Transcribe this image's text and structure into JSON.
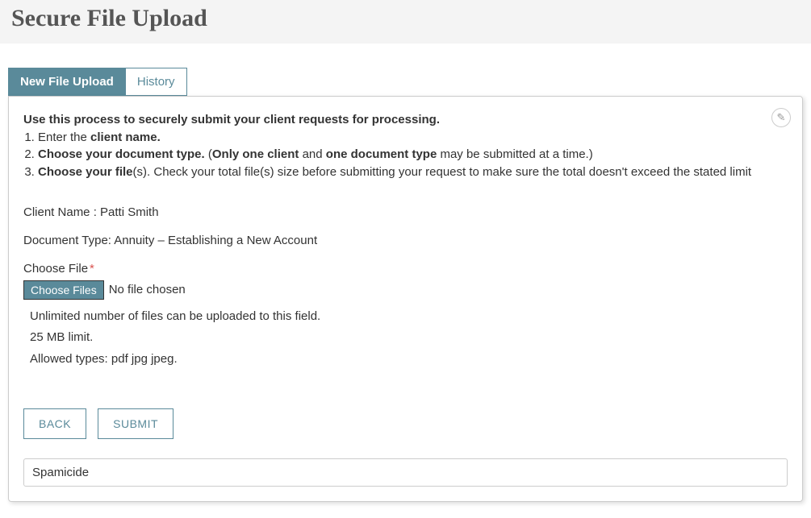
{
  "header": {
    "title": "Secure File Upload"
  },
  "tabs": {
    "new_upload": "New File Upload",
    "history": "History"
  },
  "edit_icon_name": "✎",
  "instructions": {
    "intro": "Use this process to securely submit your client requests for processing.",
    "step1_prefix": "Enter the ",
    "step1_bold": "client name.",
    "step2_bold1": "Choose your document type.",
    "step2_open_paren": " (",
    "step2_bold2": "Only one client",
    "step2_mid": " and ",
    "step2_bold3": "one document type",
    "step2_tail": " may be submitted at a time.)",
    "step3_bold": "Choose your file",
    "step3_tail": "(s). Check your total file(s) size before submitting your request to make sure the total doesn't exceed the stated limit"
  },
  "client": {
    "label": "Client Name : ",
    "value": "Patti Smith"
  },
  "document_type": {
    "label": "Document Type: ",
    "value": "Annuity – Establishing a New Account"
  },
  "file": {
    "label": "Choose File",
    "button": "Choose Files",
    "status": "No file chosen",
    "hints": {
      "unlimited": "Unlimited number of files can be uploaded to this field.",
      "limit": "25 MB limit.",
      "types": "Allowed types: pdf jpg jpeg."
    }
  },
  "actions": {
    "back": "BACK",
    "submit": "SUBMIT"
  },
  "spamicide": {
    "label": "Spamicide"
  }
}
